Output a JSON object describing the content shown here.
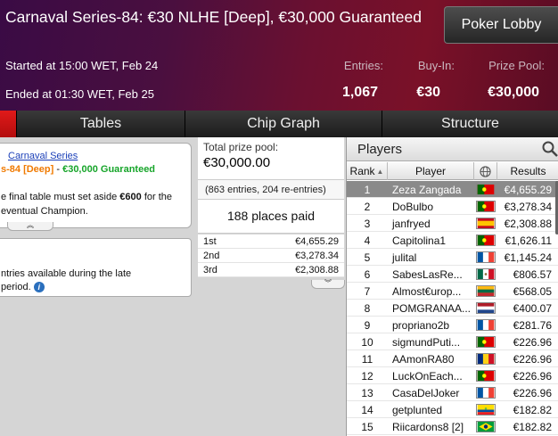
{
  "header": {
    "title": "Carnaval Series-84: €30 NLHE [Deep], €30,000 Guaranteed",
    "lobby_button": "Poker Lobby",
    "started": "Started at 15:00 WET, Feb 24",
    "ended": "Ended at 01:30 WET, Feb 25",
    "entries_label": "Entries:",
    "entries_value": "1,067",
    "buyin_label": "Buy-In:",
    "buyin_value": "€30",
    "prizepool_label": "Prize Pool:",
    "prizepool_value": "€30,000"
  },
  "tabs": [
    "",
    "Tables",
    "Chip Graph",
    "Structure"
  ],
  "info": {
    "series_link": "Carnaval Series",
    "event_name": "s-84 [Deep]",
    "separator": " - ",
    "guarantee": "€30,000 Guaranteed",
    "note_line1_pre": "e final table must set aside ",
    "note_amount": "€600",
    "note_line1_post": " for the",
    "note_line2": "eventual Champion.",
    "late_line1": "ntries available during the late",
    "late_line2": "period."
  },
  "prizes": {
    "total_label": "Total prize pool:",
    "total_value": "€30,000.00",
    "entries_note": "(863 entries, 204 re-entries)",
    "places_paid": "188 places paid",
    "payouts": [
      {
        "place": "1st",
        "amount": "€4,655.29"
      },
      {
        "place": "2nd",
        "amount": "€3,278.34"
      },
      {
        "place": "3rd",
        "amount": "€2,308.88"
      }
    ]
  },
  "players": {
    "title": "Players",
    "columns": {
      "rank": "Rank",
      "player": "Player",
      "results": "Results"
    },
    "rows": [
      {
        "rank": "1",
        "name": "Zeza Zangada",
        "flag": "portugal",
        "result": "€4,655.29"
      },
      {
        "rank": "2",
        "name": "DoBulbo",
        "flag": "portugal",
        "result": "€3,278.34"
      },
      {
        "rank": "3",
        "name": "janfryed",
        "flag": "spain",
        "result": "€2,308.88"
      },
      {
        "rank": "4",
        "name": "Capitolina1",
        "flag": "portugal",
        "result": "€1,626.11"
      },
      {
        "rank": "5",
        "name": "julital",
        "flag": "france",
        "result": "€1,145.24"
      },
      {
        "rank": "6",
        "name": "SabesLasRe...",
        "flag": "mexico",
        "result": "€806.57"
      },
      {
        "rank": "7",
        "name": "Almost€urop...",
        "flag": "lithuania",
        "result": "€568.05"
      },
      {
        "rank": "8",
        "name": "POMGRANAA...",
        "flag": "netherlands",
        "result": "€400.07"
      },
      {
        "rank": "9",
        "name": "propriano2b",
        "flag": "france",
        "result": "€281.76"
      },
      {
        "rank": "10",
        "name": "sigmundPuti...",
        "flag": "portugal",
        "result": "€226.96"
      },
      {
        "rank": "11",
        "name": "AAmonRA80",
        "flag": "romania",
        "result": "€226.96"
      },
      {
        "rank": "12",
        "name": "LuckOnEach...",
        "flag": "portugal",
        "result": "€226.96"
      },
      {
        "rank": "13",
        "name": "CasaDelJoker",
        "flag": "france",
        "result": "€226.96"
      },
      {
        "rank": "14",
        "name": "getplunted",
        "flag": "ecuador",
        "result": "€182.82"
      },
      {
        "rank": "15",
        "name": "Riicardons8 [2]",
        "flag": "brazil",
        "result": "€182.82"
      }
    ]
  },
  "colors": {
    "active_tab": "#d31515",
    "guarantee_green": "#17a52a",
    "event_orange": "#f07a00",
    "selected_row": "#8a8a8a"
  }
}
